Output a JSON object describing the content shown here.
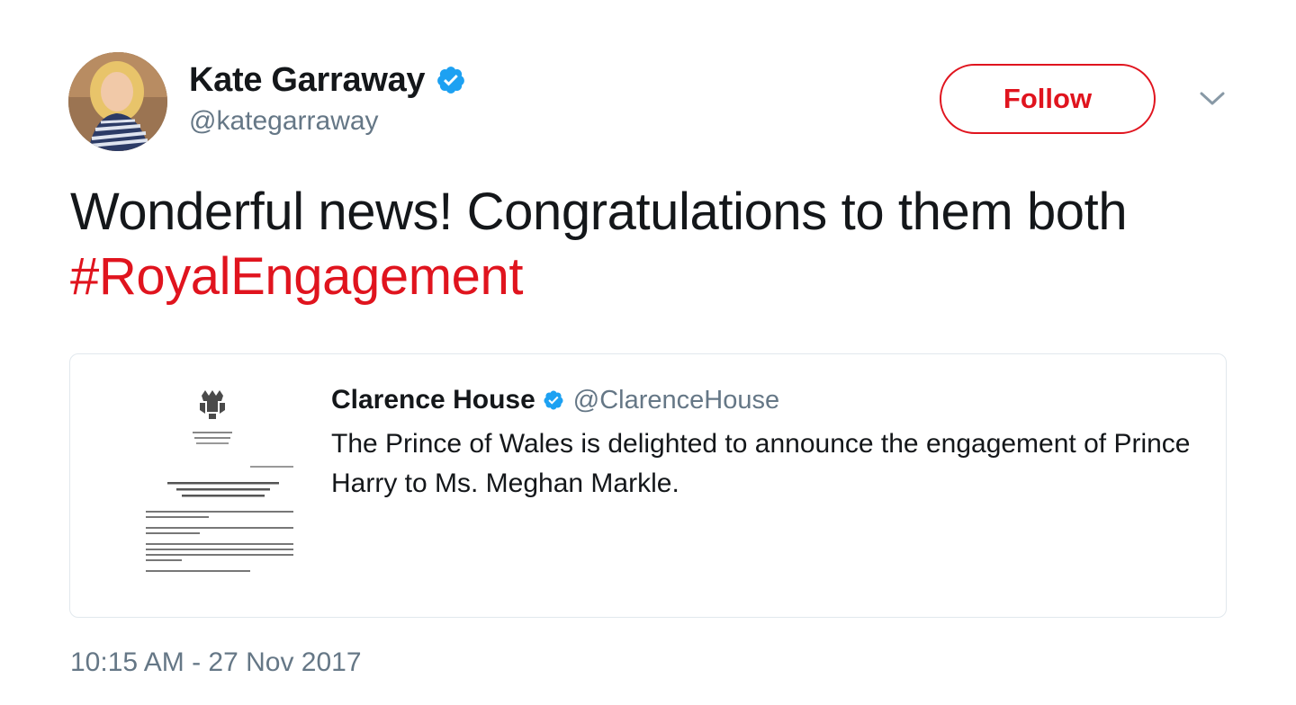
{
  "author": {
    "display_name": "Kate Garraway",
    "handle": "@kategarraway",
    "verified": true
  },
  "follow_button": {
    "label": "Follow"
  },
  "tweet": {
    "text": "Wonderful news! Congratulations to them both",
    "hashtag": "#RoyalEngagement"
  },
  "quoted_tweet": {
    "display_name": "Clarence House",
    "handle": "@ClarenceHouse",
    "verified": true,
    "text": "The Prince of Wales is delighted to announce the engagement of Prince Harry to Ms. Meghan Markle."
  },
  "timestamp": "10:15 AM - 27 Nov 2017",
  "icons": {
    "verified": "verified-badge-icon",
    "menu": "chevron-down-icon",
    "crest": "royal-crest-icon"
  },
  "colors": {
    "accent": "#e0141e",
    "verified": "#1da1f2",
    "secondary_text": "#657786",
    "border": "#e1e8ed"
  }
}
